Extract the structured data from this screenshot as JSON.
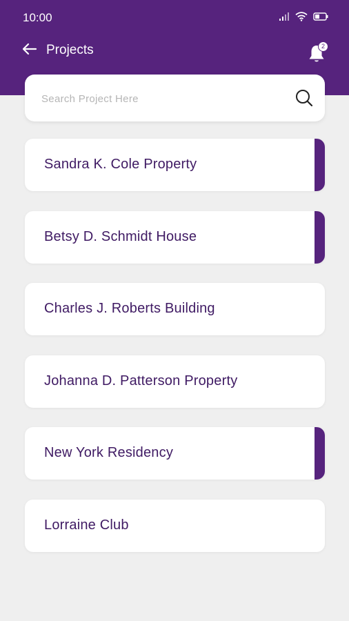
{
  "status_bar": {
    "time": "10:00",
    "icons": [
      "signal-icon",
      "wifi-icon",
      "battery-icon"
    ]
  },
  "toolbar": {
    "title": "Projects",
    "back_icon": "arrow-left-icon",
    "notification_icon": "bell-icon",
    "notification_count": "2"
  },
  "search": {
    "placeholder": "Search Project Here",
    "value": "",
    "icon": "search-icon"
  },
  "projects": [
    {
      "name": "Sandra K. Cole Property",
      "flagged": true
    },
    {
      "name": "Betsy D. Schmidt House",
      "flagged": true
    },
    {
      "name": "Charles J. Roberts Building",
      "flagged": false
    },
    {
      "name": "Johanna D. Patterson Property",
      "flagged": false
    },
    {
      "name": "New York Residency",
      "flagged": true
    },
    {
      "name": "Lorraine Club",
      "flagged": false
    }
  ],
  "colors": {
    "primary": "#56237d",
    "text": "#3f1a63",
    "background": "#efefef",
    "card": "#ffffff"
  }
}
